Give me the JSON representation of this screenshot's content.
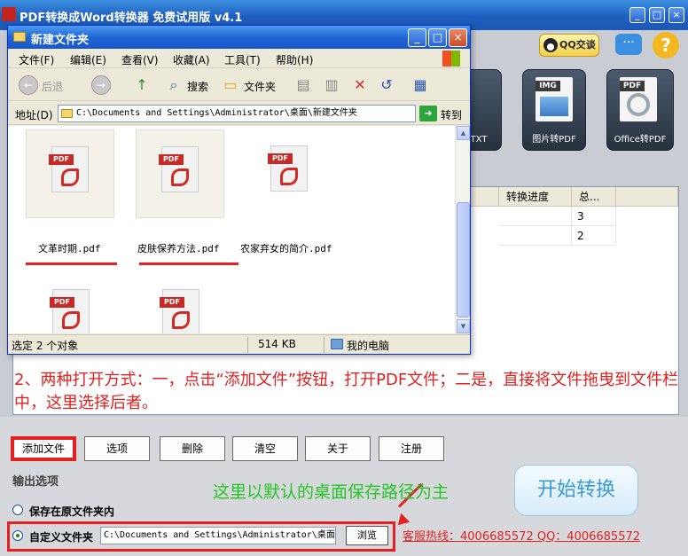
{
  "app": {
    "title": "PDF转换成Word转换器 免费试用版 v4.1",
    "qq_button": "QQ交谈",
    "tool_cards": [
      {
        "tag": "",
        "label": "TXT"
      },
      {
        "tag": "IMG",
        "label": "图片转PDF"
      },
      {
        "tag": "PDF",
        "label": "Office转PDF"
      }
    ],
    "list_headers": [
      "转换进度",
      "总..."
    ],
    "list_rows": [
      [
        "",
        "3"
      ],
      [
        "",
        "2"
      ]
    ],
    "instruction": "2、两种打开方式：一，点击“添加文件”按钮，打开PDF文件；二是，直接将文件拖曳到文件栏中，这里选择后者。",
    "action_buttons": [
      "添加文件",
      "选项",
      "删除",
      "清空",
      "关于",
      "注册"
    ],
    "output_section": "输出选项",
    "radio_original": "保存在原文件夹内",
    "radio_custom": "自定义文件夹",
    "custom_path": "C:\\Documents and Settings\\Administrator\\桌面",
    "browse_button": "浏览",
    "start_button": "开始转换",
    "green_note": "这里以默认的桌面保存路径为主",
    "hotline": "客服热线：4006685572 QQ：4006685572",
    "colors": {
      "accent_red": "#e52020",
      "note_green": "#26c426",
      "title_blue": "#1e5fbf"
    }
  },
  "explorer": {
    "title": "新建文件夹",
    "menu": [
      "文件(F)",
      "编辑(E)",
      "查看(V)",
      "收藏(A)",
      "工具(T)",
      "帮助(H)"
    ],
    "toolbar": {
      "back": "后退",
      "search": "搜索",
      "folders": "文件夹"
    },
    "address_label": "地址(D)",
    "address_value": "C:\\Documents and Settings\\Administrator\\桌面\\新建文件夹",
    "go_label": "转到",
    "files": [
      {
        "name": "文革时期.pdf",
        "selected": true
      },
      {
        "name": "皮肤保养方法.pdf",
        "selected": true
      },
      {
        "name": "农家弃女的简介.pdf",
        "selected": false
      },
      {
        "name": "",
        "selected": false
      },
      {
        "name": "",
        "selected": false
      }
    ],
    "status": {
      "selection": "选定 2 个对象",
      "size": "514 KB",
      "location": "我的电脑"
    }
  }
}
